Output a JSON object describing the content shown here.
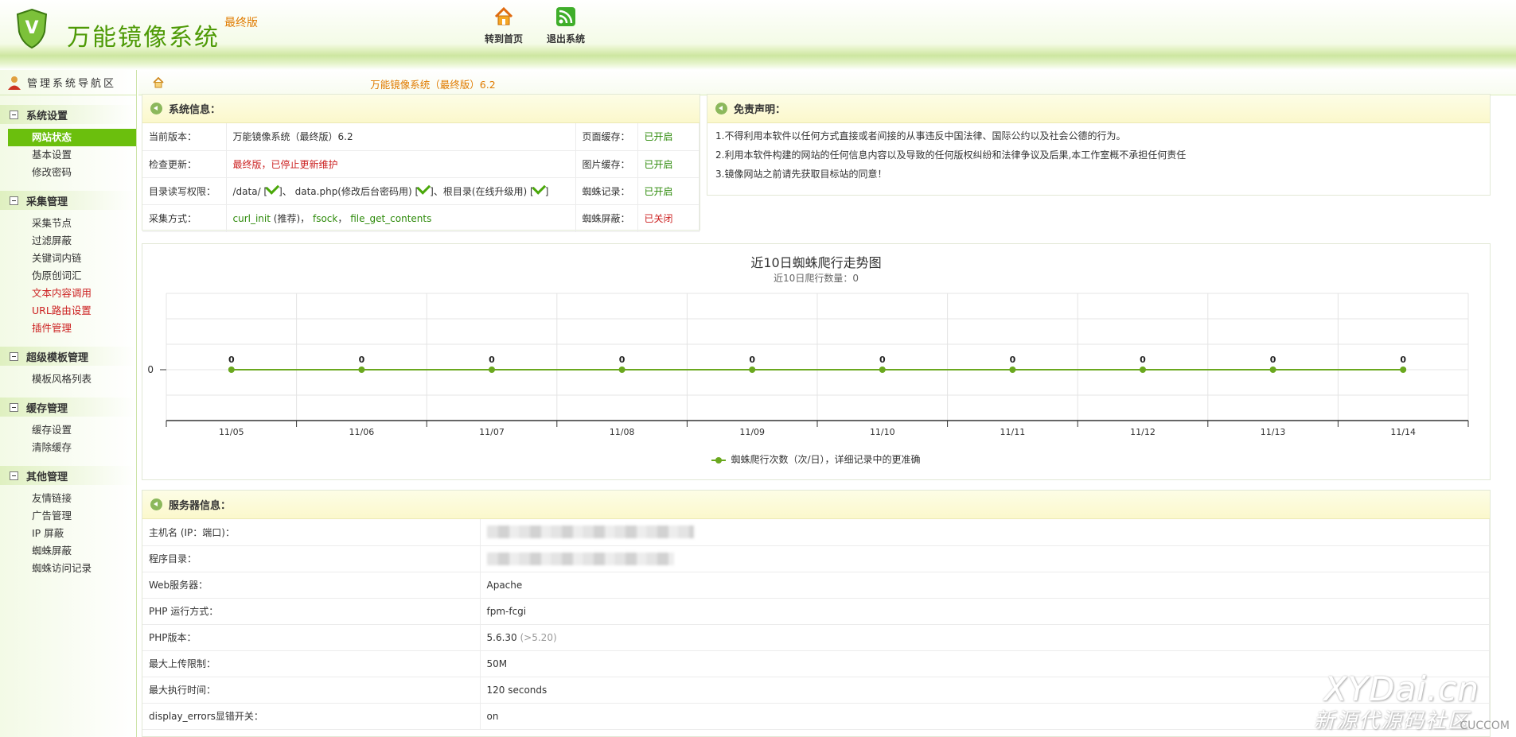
{
  "header": {
    "title": "万能镜像系统",
    "badge": "最终版",
    "nav": [
      {
        "label": "转到首页",
        "icon": "home-icon"
      },
      {
        "label": "退出系统",
        "icon": "rss-icon"
      }
    ]
  },
  "sidebar": {
    "title": "管理系统导航区",
    "groups": [
      {
        "title": "系统设置",
        "items": [
          "网站状态",
          "基本设置",
          "修改密码"
        ]
      },
      {
        "title": "采集管理",
        "items": [
          "采集节点",
          "过滤屏蔽",
          "关键词内链",
          "伪原创词汇",
          "文本内容调用",
          "URL路由设置",
          "插件管理"
        ]
      },
      {
        "title": "超级模板管理",
        "items": [
          "模板风格列表"
        ]
      },
      {
        "title": "缓存管理",
        "items": [
          "缓存设置",
          "清除缓存"
        ]
      },
      {
        "title": "其他管理",
        "items": [
          "友情链接",
          "广告管理",
          "IP 屏蔽",
          "蜘蛛屏蔽",
          "蜘蛛访问记录"
        ]
      }
    ]
  },
  "breadcrumb": {
    "title": "万能镜像系统（最终版）6.2"
  },
  "sysinfo": {
    "title": "系统信息：",
    "rows": [
      {
        "label": "当前版本：",
        "value": "万能镜像系统（最终版）6.2",
        "label2": "页面缓存：",
        "value2": "已开启"
      },
      {
        "label": "检查更新：",
        "value": "最终版，已停止更新维护",
        "label2": "图片缓存：",
        "value2": "已开启"
      },
      {
        "label": "目录读写权限：",
        "dir1": "/data/ [",
        "dir1e": "]、",
        "dir2": " data.php(修改后台密码用) [",
        "dir2e": "]、",
        "dir3": "根目录(在线升级用) [",
        "dir3e": "]",
        "label2": "蜘蛛记录：",
        "value2": "已开启"
      },
      {
        "label": "采集方式：",
        "m1": "curl_init",
        "m1note": " (推荐)，",
        "m2": "fsock",
        "sep": "，",
        "m3": "file_get_contents",
        "label2": "蜘蛛屏蔽：",
        "value2": "已关闭"
      }
    ]
  },
  "disclaimer": {
    "title": "免责声明：",
    "lines": [
      "1.不得利用本软件以任何方式直接或者间接的从事违反中国法律、国际公约以及社会公德的行为。",
      "2.利用本软件构建的网站的任何信息内容以及导致的任何版权纠纷和法律争议及后果,本工作室概不承担任何责任",
      "3.镜像网站之前请先获取目标站的同意！"
    ]
  },
  "chart_data": {
    "type": "line",
    "title": "近10日蜘蛛爬行走势图",
    "subtitle": "近10日爬行数量：0",
    "categories": [
      "11/05",
      "11/06",
      "11/07",
      "11/08",
      "11/09",
      "11/10",
      "11/11",
      "11/12",
      "11/13",
      "11/14"
    ],
    "series": [
      {
        "name": "蜘蛛爬行次数（次/日），详细记录中的更准确",
        "values": [
          0,
          0,
          0,
          0,
          0,
          0,
          0,
          0,
          0,
          0
        ],
        "color": "#6aa81e"
      }
    ],
    "y_ticks": [
      0
    ],
    "grid": true,
    "legend": "bottom"
  },
  "server": {
    "title": "服务器信息：",
    "rows": [
      {
        "label": "主机名 (IP：端口)：",
        "value": "",
        "blurred": true
      },
      {
        "label": "程序目录：",
        "value": "",
        "blurred": true
      },
      {
        "label": "Web服务器：",
        "value": "Apache"
      },
      {
        "label": "PHP 运行方式：",
        "value": "fpm-fcgi"
      },
      {
        "label": "PHP版本：",
        "value": "5.6.30",
        "note": "(>5.20)"
      },
      {
        "label": "最大上传限制：",
        "value": "50M"
      },
      {
        "label": "最大执行时间：",
        "value": "120 seconds"
      },
      {
        "label": "display_errors显错开关：",
        "value": "on"
      }
    ]
  },
  "watermark": {
    "line1": "XYDai.cn",
    "line2": "新源代源码社区",
    "line3": "CUCCOM"
  }
}
